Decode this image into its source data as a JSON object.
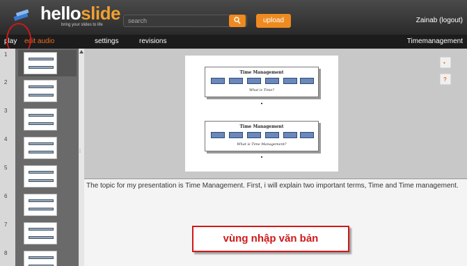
{
  "brand": {
    "name_a": "hello",
    "name_b": "slide",
    "tagline": "bring your slides to life",
    "accent": "#ee8a20"
  },
  "search": {
    "placeholder": "search"
  },
  "header": {
    "upload_label": "upload",
    "user": "Zainab (logout)"
  },
  "tabs": [
    {
      "label": "play"
    },
    {
      "label": "edit audio"
    },
    {
      "label": "settings"
    },
    {
      "label": "revisions"
    }
  ],
  "presentation_title": "Timemanagement",
  "thumbnails": [
    "1",
    "2",
    "3",
    "4",
    "5",
    "6",
    "7",
    "8"
  ],
  "slide": {
    "box1_title": "Time Management",
    "box1_subtitle": "What is Time?",
    "box2_title": "Time Management",
    "box2_subtitle": "What is Time Management?"
  },
  "side_buttons": {
    "save_icon": "save-icon",
    "help_label": "?"
  },
  "notes": {
    "text": "The topic for my presentation is Time Management. First, i will explain two important terms, Time and Time management.",
    "callout": "vùng nhập văn bản"
  }
}
